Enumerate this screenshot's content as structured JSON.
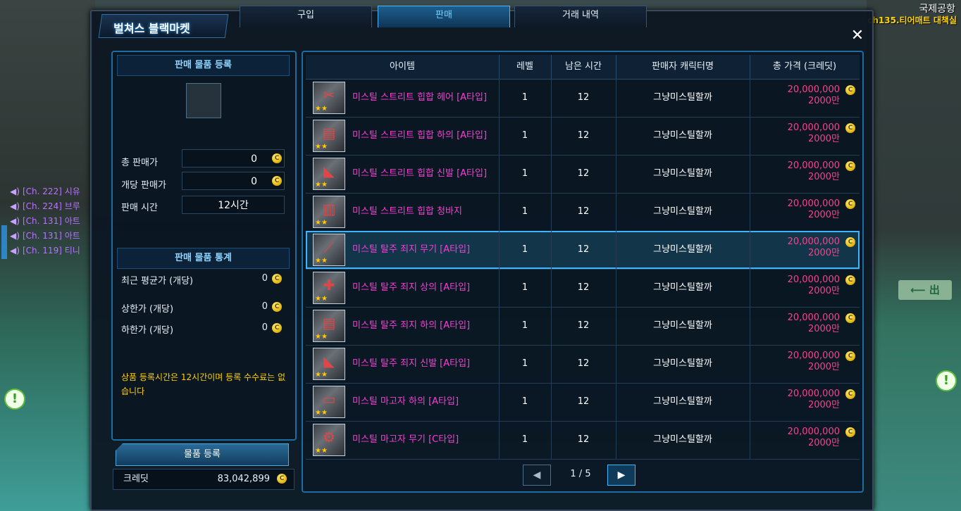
{
  "scene": {
    "location_title": "국제공항",
    "location_sub": "ch135.티어매트 대책실",
    "exit_sign": "⟵ 出"
  },
  "chat": [
    {
      "text": "[Ch. 222] 시유"
    },
    {
      "text": "[Ch. 224] 브루"
    },
    {
      "text": "[Ch. 131] 아트"
    },
    {
      "text": "[Ch. 131] 아트"
    },
    {
      "text": "[Ch. 119] 티니"
    }
  ],
  "window": {
    "title": "벌쳐스 블랙마켓",
    "close": "✕",
    "tabs": [
      "구입",
      "판매",
      "거래 내역"
    ],
    "active_tab": 1
  },
  "sell_form": {
    "header": "판매 물품 등록",
    "total_price_label": "총 판매가",
    "total_price_value": "0",
    "unit_price_label": "개당 판매가",
    "unit_price_value": "0",
    "sell_time_label": "판매 시간",
    "sell_time_value": "12시간"
  },
  "stats": {
    "header": "판매 물품 통계",
    "recent_avg_label": "최근 평균가 (개당)",
    "recent_avg_value": "0",
    "upper_label": "상한가 (개당)",
    "upper_value": "0",
    "lower_label": "하한가 (개당)",
    "lower_value": "0"
  },
  "note": "상품 등록시간은 12시간이며 등록 수수료는 없습니다",
  "register_button": "물품 등록",
  "credit": {
    "label": "크레딧",
    "value": "83,042,899"
  },
  "table": {
    "columns": [
      "아이템",
      "레벨",
      "남은 시간",
      "판매자 캐릭터명",
      "총 가격 (크레딧)"
    ],
    "rows": [
      {
        "name": "미스틸 스트리트 힙합 헤어 [A타입]",
        "level": "1",
        "time": "12",
        "seller": "그냥미스틸할까",
        "price": "20,000,000",
        "price_short": "2000만"
      },
      {
        "name": "미스틸 스트리트 힙합 하의 [A타입]",
        "level": "1",
        "time": "12",
        "seller": "그냥미스틸할까",
        "price": "20,000,000",
        "price_short": "2000만"
      },
      {
        "name": "미스틸 스트리트 힙합 신발 [A타입]",
        "level": "1",
        "time": "12",
        "seller": "그냥미스틸할까",
        "price": "20,000,000",
        "price_short": "2000만"
      },
      {
        "name": "미스틸 스트리트 힙합 청바지",
        "level": "1",
        "time": "12",
        "seller": "그냥미스틸할까",
        "price": "20,000,000",
        "price_short": "2000만"
      },
      {
        "name": "미스틸 탈주 죄지 무기 [A타입]",
        "level": "1",
        "time": "12",
        "seller": "그냥미스틸할까",
        "price": "20,000,000",
        "price_short": "2000만"
      },
      {
        "name": "미스틸 탈주 죄지 상의 [A타입]",
        "level": "1",
        "time": "12",
        "seller": "그냥미스틸할까",
        "price": "20,000,000",
        "price_short": "2000만"
      },
      {
        "name": "미스틸 탈주 죄지 하의 [A타입]",
        "level": "1",
        "time": "12",
        "seller": "그냥미스틸할까",
        "price": "20,000,000",
        "price_short": "2000만"
      },
      {
        "name": "미스틸 탈주 죄지 신발 [A타입]",
        "level": "1",
        "time": "12",
        "seller": "그냥미스틸할까",
        "price": "20,000,000",
        "price_short": "2000만"
      },
      {
        "name": "미스틸 마고자 하의 [A타입]",
        "level": "1",
        "time": "12",
        "seller": "그냥미스틸할까",
        "price": "20,000,000",
        "price_short": "2000만"
      },
      {
        "name": "미스틸 마고자 무기 [C타입]",
        "level": "1",
        "time": "12",
        "seller": "그냥미스틸할까",
        "price": "20,000,000",
        "price_short": "2000만"
      }
    ],
    "selected_row": 4
  },
  "pager": {
    "label": "1 / 5",
    "prev": "◀",
    "next": "▶"
  },
  "coin_symbol": "C"
}
